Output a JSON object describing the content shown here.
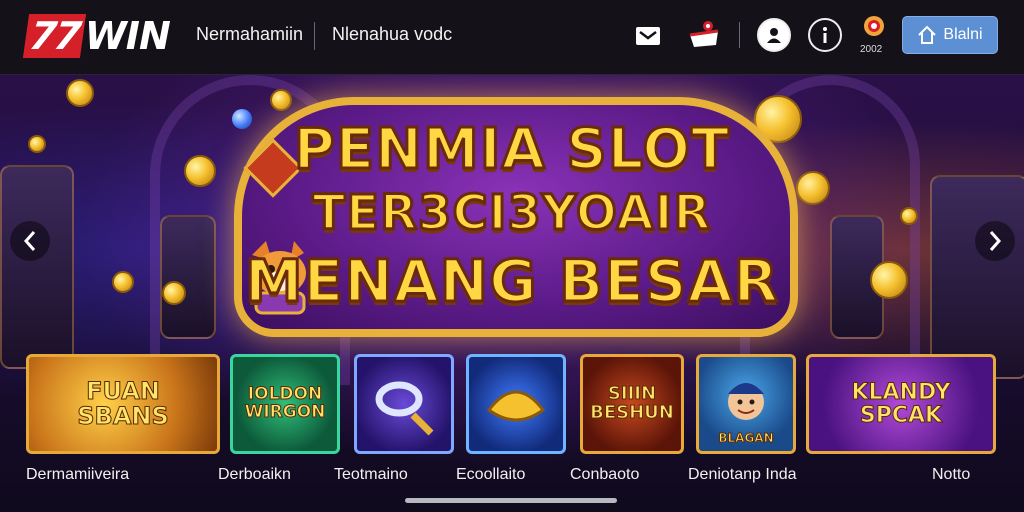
{
  "brand": {
    "logo_number": "77",
    "logo_word": "WIN"
  },
  "nav": {
    "link1": "Nermahamiin",
    "link2": "Nlenahua vodc"
  },
  "header_icons": {
    "mail": "mail-icon",
    "gift": "gift-icon",
    "user": "user-icon",
    "info": "info-icon",
    "badge": "badge-icon"
  },
  "badge_label": "2002",
  "login": {
    "label": "Blalni"
  },
  "hero": {
    "line1": "PENMIA SLOT",
    "line2": "TER3CI3YOAIR",
    "line3": "MENANG BESAR"
  },
  "games": [
    {
      "title": "FUAN\nSBANS",
      "label": "Dermamiiveira"
    },
    {
      "title": "IOLDON\nWIRGON",
      "label": "Derboaikn"
    },
    {
      "title": "",
      "label": "Teotmaino"
    },
    {
      "title": "",
      "label": "Ecoollaito"
    },
    {
      "title": "SIIIN\nBESHUN",
      "label": "Conbaoto"
    },
    {
      "title": "BLAGAN",
      "label": "Deniotanp Inda"
    },
    {
      "title": "KLANDY\nSPCAK",
      "label": "Notto"
    }
  ]
}
